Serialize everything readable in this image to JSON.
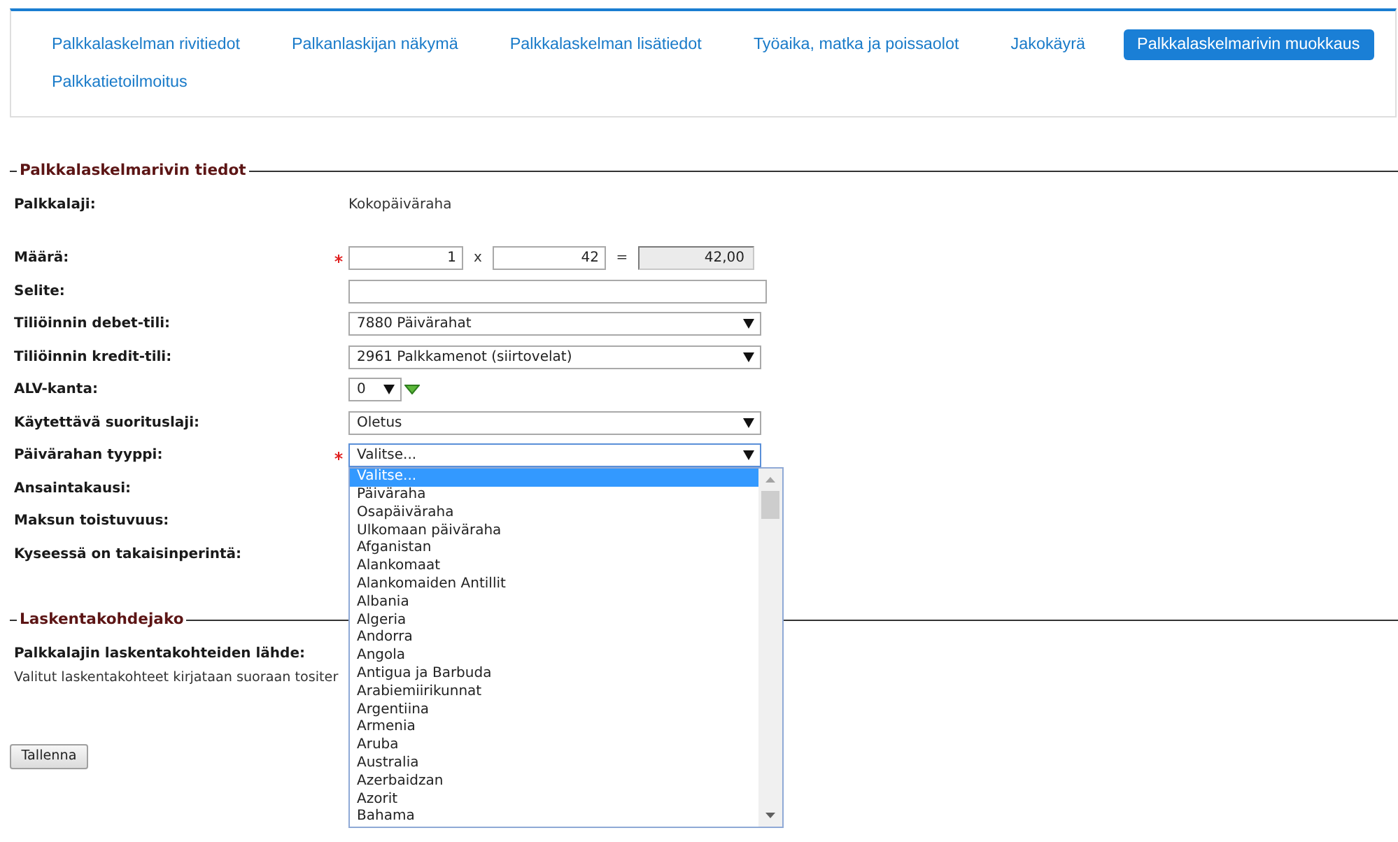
{
  "nav_tabs": [
    {
      "label": "Palkkalaskelman rivitiedot",
      "selected": false
    },
    {
      "label": "Palkanlaskijan näkymä",
      "selected": false
    },
    {
      "label": "Palkkalaskelman lisätiedot",
      "selected": false
    },
    {
      "label": "Työaika, matka ja poissaolot",
      "selected": false
    },
    {
      "label": "Jakokäyrä",
      "selected": false
    },
    {
      "label": "Palkkalaskelmarivin muokkaus",
      "selected": true
    },
    {
      "label": "Palkkatietoilmoitus",
      "selected": false
    }
  ],
  "sections": [
    {
      "legend": "Palkkalaskelmarivin tiedot",
      "rows": [
        {
          "kind": "text",
          "label": "Palkkalaji:",
          "required": false,
          "value": "Kokopäiväraha"
        },
        {
          "kind": "quantity",
          "label": "Määrä:",
          "required": true,
          "amount": "1",
          "operator": "x",
          "unit_price": "42",
          "equals": "=",
          "total": "42,00"
        },
        {
          "kind": "input",
          "label": "Selite:",
          "required": false
        },
        {
          "kind": "select",
          "label": "Tiliöinnin debet-tili:",
          "required": false,
          "value": "7880 Päivärahat",
          "expanded": false
        },
        {
          "kind": "select",
          "label": "Tiliöinnin kredit-tili:",
          "required": false,
          "value": "2961 Palkkamenot (siirtovelat)",
          "expanded": false
        },
        {
          "kind": "small_select",
          "label": "ALV-kanta:",
          "required": false,
          "value": "0"
        },
        {
          "kind": "select",
          "label": "Käytettävä suorituslaji:",
          "required": false,
          "value": "Oletus",
          "expanded": false
        },
        {
          "kind": "select",
          "label": "Päivärahan tyyppi:",
          "required": true,
          "value": "Valitse...",
          "expanded": true,
          "options": [
            {
              "label": "Valitse...",
              "selected": true
            },
            {
              "label": "Päiväraha",
              "selected": false
            },
            {
              "label": "Osapäiväraha",
              "selected": false
            },
            {
              "label": "Ulkomaan päiväraha",
              "selected": false
            },
            {
              "label": "Afganistan",
              "selected": false
            },
            {
              "label": "Alankomaat",
              "selected": false
            },
            {
              "label": "Alankomaiden Antillit",
              "selected": false
            },
            {
              "label": "Albania",
              "selected": false
            },
            {
              "label": "Algeria",
              "selected": false
            },
            {
              "label": "Andorra",
              "selected": false
            },
            {
              "label": "Angola",
              "selected": false
            },
            {
              "label": "Antigua ja Barbuda",
              "selected": false
            },
            {
              "label": "Arabiemiirikunnat",
              "selected": false
            },
            {
              "label": "Argentiina",
              "selected": false
            },
            {
              "label": "Armenia",
              "selected": false
            },
            {
              "label": "Aruba",
              "selected": false
            },
            {
              "label": "Australia",
              "selected": false
            },
            {
              "label": "Azerbaidzan",
              "selected": false
            },
            {
              "label": "Azorit",
              "selected": false
            },
            {
              "label": "Bahama",
              "selected": false
            }
          ]
        },
        {
          "kind": "label",
          "label": "Ansaintakausi:",
          "required": false
        },
        {
          "kind": "label",
          "label": "Maksun toistuvuus:",
          "required": false
        },
        {
          "kind": "label",
          "label": "Kyseessä on takaisinperintä:",
          "required": false
        }
      ]
    },
    {
      "legend": "Laskentakohdejako",
      "rows": [
        {
          "kind": "heading",
          "label": "Palkkalajin laskentakohteiden lähde:"
        },
        {
          "kind": "note",
          "text": "Valitut laskentakohteet kirjataan suoraan tositer"
        }
      ]
    }
  ],
  "save_button": "Tallenna"
}
